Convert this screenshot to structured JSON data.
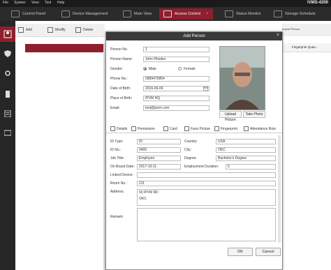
{
  "app": {
    "title": "iVMS-4200",
    "menu": [
      "File",
      "System",
      "View",
      "Tool",
      "Help"
    ]
  },
  "tabs": [
    {
      "label": "Control Panel"
    },
    {
      "label": "Device Management"
    },
    {
      "label": "Main View"
    },
    {
      "label": "Access Control"
    },
    {
      "label": "Status Monitor"
    },
    {
      "label": "Storage Schedule"
    }
  ],
  "background": {
    "toolbar": {
      "add": "Add",
      "modify": "Modify",
      "delete": "Delete"
    },
    "right_toolbar": {
      "import_person": "Import Person",
      "export_person": "Export Person",
      "get_person": "Get Person"
    },
    "column_header": "Fingerprint Quan..."
  },
  "dialog": {
    "title": "Add Person",
    "close": "×",
    "basic": {
      "person_no": {
        "label": "Person No.",
        "value": "1"
      },
      "person_name": {
        "label": "Person Name:",
        "value": "John Rhodes"
      },
      "gender": {
        "label": "Gender:",
        "male": "Male",
        "female": "Female",
        "selected": "Male"
      },
      "phone_no": {
        "label": "Phone No.:",
        "value": "0989475854"
      },
      "date_of_birth": {
        "label": "Date of Birth:",
        "value": "2016-06-06"
      },
      "place_of_birth": {
        "label": "Place of Birth:",
        "value": "IPVM HQ"
      },
      "email": {
        "label": "Email:",
        "value": "test@ipvm.com"
      }
    },
    "photo_buttons": {
      "upload": "Upload Picture",
      "take": "Take Photo"
    },
    "subtabs": [
      "Details",
      "Permission",
      "Card",
      "Face Picture",
      "Fingerprint",
      "Attendance Rule"
    ],
    "details": {
      "id_type": {
        "label": "ID Type:",
        "value": "ID"
      },
      "country": {
        "label": "Country:",
        "value": "USA"
      },
      "id_no": {
        "label": "ID No.:",
        "value": "0405"
      },
      "city": {
        "label": "City:",
        "value": "OKC"
      },
      "job_title": {
        "label": "Job Title:",
        "value": "Employee"
      },
      "degree": {
        "label": "Degree:",
        "value": "Bachelor's Degree"
      },
      "on_board_date": {
        "label": "On Board Date:",
        "value": "2017-10-11"
      },
      "employment_duration": {
        "label": "Employment Duration:",
        "value": "5"
      },
      "linked_device": {
        "label": "Linked Device:",
        "value": ""
      },
      "room_no": {
        "label": "Room No.:",
        "value": "211"
      },
      "address": {
        "label": "Address:",
        "value": "50 IPVM RD"
      },
      "address2": {
        "value": "OKC"
      },
      "remark": {
        "label": "Remark:",
        "value": ""
      }
    },
    "buttons": {
      "ok": "OK",
      "cancel": "Cancel"
    }
  }
}
